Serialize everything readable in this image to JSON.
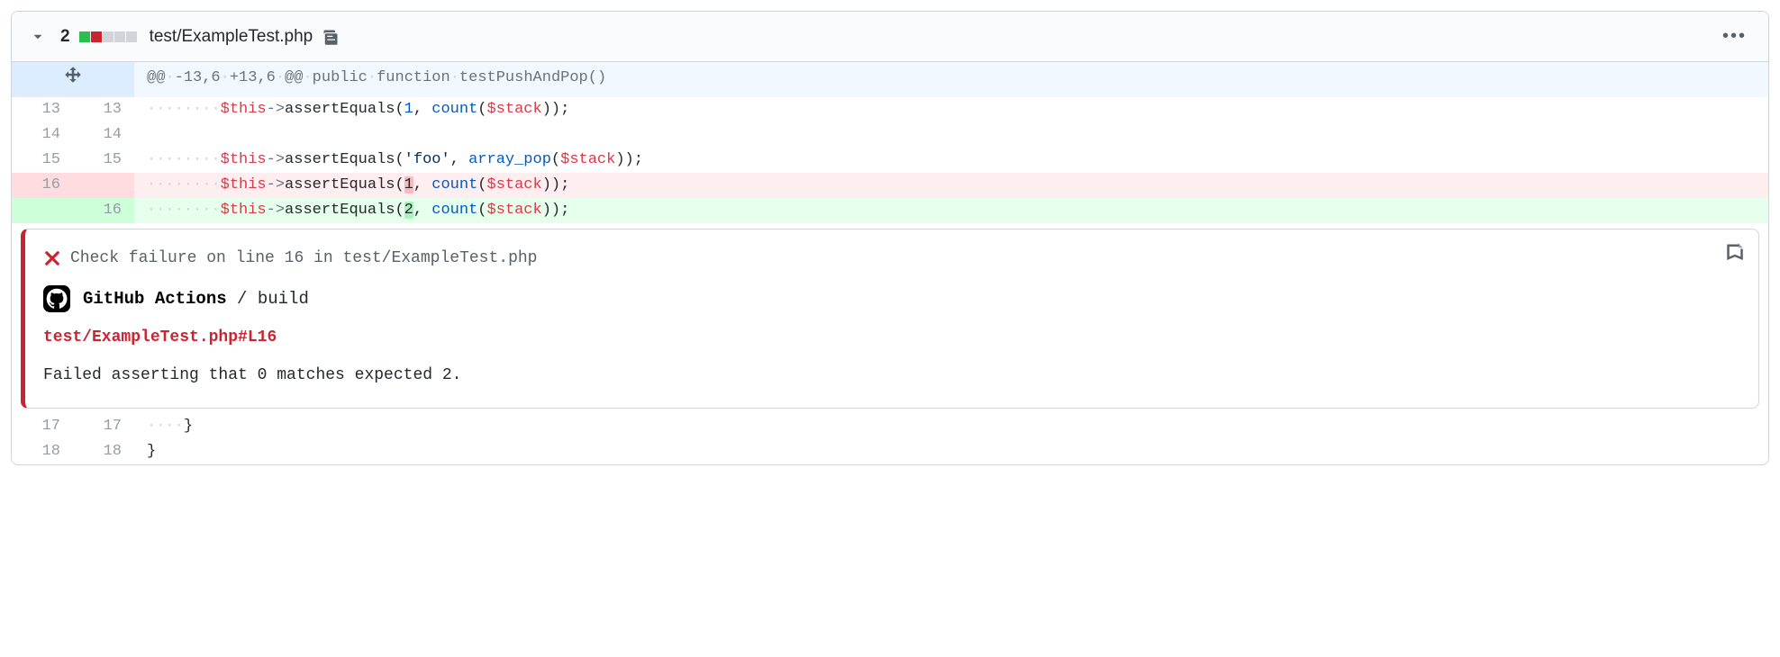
{
  "file": {
    "change_count": "2",
    "name": "test/ExampleTest.php",
    "diffstat": {
      "added": 1,
      "removed": 1,
      "neutral": 3
    }
  },
  "hunk": {
    "header": "@@ -13,6 +13,6 @@ public function testPushAndPop()"
  },
  "lines": [
    {
      "type": "ctx",
      "old": "13",
      "new": "13",
      "ws": 8,
      "segs": [
        [
          "var",
          "$this"
        ],
        [
          "dim",
          "->"
        ],
        [
          "",
          "assertEquals"
        ],
        [
          "",
          "("
        ],
        [
          "num",
          "1"
        ],
        [
          "",
          ", "
        ],
        [
          "fn",
          "count"
        ],
        [
          "",
          "("
        ],
        [
          "var",
          "$stack"
        ],
        [
          "",
          ")"
        ],
        [
          "",
          ")"
        ],
        [
          "",
          ";"
        ]
      ]
    },
    {
      "type": "ctx",
      "old": "14",
      "new": "14",
      "ws": 0,
      "segs": []
    },
    {
      "type": "ctx",
      "old": "15",
      "new": "15",
      "ws": 8,
      "segs": [
        [
          "var",
          "$this"
        ],
        [
          "dim",
          "->"
        ],
        [
          "",
          "assertEquals"
        ],
        [
          "",
          "("
        ],
        [
          "str",
          "'foo'"
        ],
        [
          "",
          ", "
        ],
        [
          "fn",
          "array_pop"
        ],
        [
          "",
          "("
        ],
        [
          "var",
          "$stack"
        ],
        [
          "",
          ")"
        ],
        [
          "",
          ")"
        ],
        [
          "",
          ";"
        ]
      ]
    },
    {
      "type": "del",
      "old": "16",
      "new": "",
      "ws": 8,
      "segs": [
        [
          "var",
          "$this"
        ],
        [
          "dim",
          "->"
        ],
        [
          "",
          "assertEquals"
        ],
        [
          "",
          "("
        ],
        [
          "hl-del",
          "1"
        ],
        [
          "",
          ", "
        ],
        [
          "fn",
          "count"
        ],
        [
          "",
          "("
        ],
        [
          "var",
          "$stack"
        ],
        [
          "",
          ")"
        ],
        [
          "",
          ")"
        ],
        [
          "",
          ";"
        ]
      ]
    },
    {
      "type": "add",
      "old": "",
      "new": "16",
      "ws": 8,
      "segs": [
        [
          "var",
          "$this"
        ],
        [
          "dim",
          "->"
        ],
        [
          "",
          "assertEquals"
        ],
        [
          "",
          "("
        ],
        [
          "hl-add",
          "2"
        ],
        [
          "",
          ", "
        ],
        [
          "fn",
          "count"
        ],
        [
          "",
          "("
        ],
        [
          "var",
          "$stack"
        ],
        [
          "",
          ")"
        ],
        [
          "",
          ")"
        ],
        [
          "",
          ";"
        ]
      ]
    },
    {
      "type": "ctx",
      "old": "17",
      "new": "17",
      "ws": 4,
      "segs": [
        [
          "",
          "}"
        ]
      ]
    },
    {
      "type": "ctx",
      "old": "18",
      "new": "18",
      "ws": 0,
      "segs": [
        [
          "",
          "}"
        ]
      ]
    }
  ],
  "annotation": {
    "after_line_index": 4,
    "title": "Check failure on line 16 in test/ExampleTest.php",
    "source_app": "GitHub Actions",
    "source_check": "build",
    "link_text": "test/ExampleTest.php#L16",
    "message": "Failed asserting that 0 matches expected 2."
  }
}
